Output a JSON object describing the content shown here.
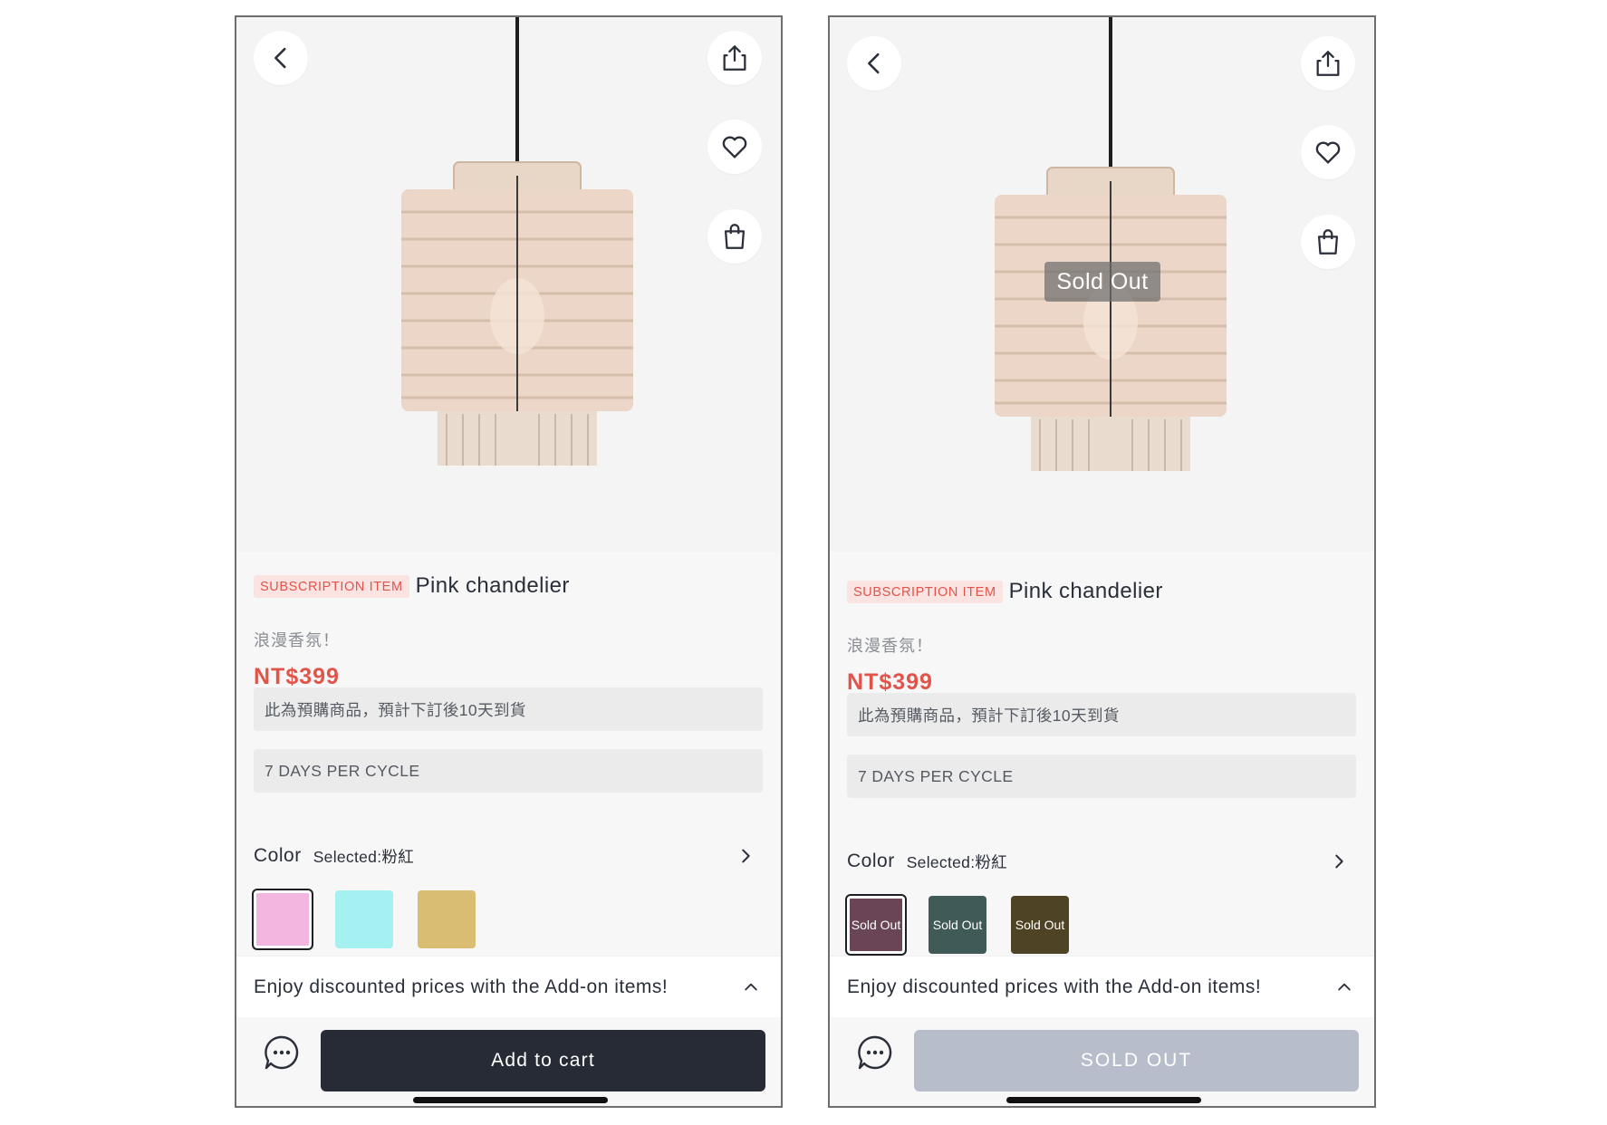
{
  "screens": [
    {
      "id": "left",
      "nav": {
        "back_icon": "chevron-left-icon",
        "share_icon": "share-icon",
        "wishlist_icon": "heart-icon",
        "cart_icon": "shopping-bag-icon"
      },
      "product": {
        "tag": "SUBSCRIPTION ITEM",
        "title": "Pink chandelier",
        "subtitle": "浪漫香氛！",
        "price": "NT$399",
        "preorder_note": "此為預購商品，預計下訂後10天到貨",
        "cycle_note": "7 DAYS PER CYCLE",
        "sold_out_overlay": ""
      },
      "variant": {
        "label": "Color",
        "selected_text": "Selected:粉紅",
        "swatches": [
          {
            "color": "#f2b6e1",
            "text": "",
            "selected": true
          },
          {
            "color": "#a5f0f0",
            "text": "",
            "selected": false
          },
          {
            "color": "#d8bd72",
            "text": "",
            "selected": false
          }
        ]
      },
      "addon_banner": "Enjoy discounted prices with the Add-on items!",
      "cta": {
        "label": "Add to cart",
        "state": "enabled"
      },
      "chat_icon": "chat-bubble-icon"
    },
    {
      "id": "right",
      "nav": {
        "back_icon": "chevron-left-icon",
        "share_icon": "share-icon",
        "wishlist_icon": "heart-icon",
        "cart_icon": "shopping-bag-icon"
      },
      "product": {
        "tag": "SUBSCRIPTION ITEM",
        "title": "Pink chandelier",
        "subtitle": "浪漫香氛！",
        "price": "NT$399",
        "preorder_note": "此為預購商品，預計下訂後10天到貨",
        "cycle_note": "7 DAYS PER CYCLE",
        "sold_out_overlay": "Sold Out"
      },
      "variant": {
        "label": "Color",
        "selected_text": "Selected:粉紅",
        "swatches": [
          {
            "color": "#6a4556",
            "text": "Sold Out",
            "selected": true
          },
          {
            "color": "#3f5a57",
            "text": "Sold Out",
            "selected": false
          },
          {
            "color": "#4f4325",
            "text": "Sold Out",
            "selected": false
          }
        ]
      },
      "addon_banner": "Enjoy discounted prices with the Add-on items!",
      "cta": {
        "label": "SOLD OUT",
        "state": "disabled"
      },
      "chat_icon": "chat-bubble-icon"
    }
  ],
  "colors": {
    "accent_red": "#e0544a",
    "tag_bg": "#fbe3e1",
    "cta_dark": "#262b35",
    "cta_disabled": "#b7bdcb"
  }
}
